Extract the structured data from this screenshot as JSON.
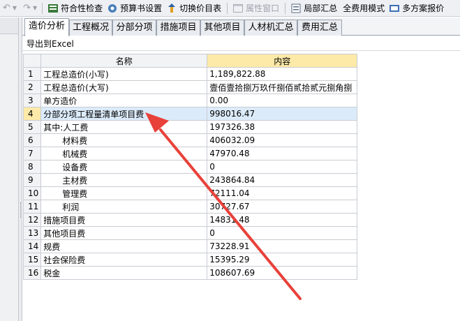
{
  "toolbar": {
    "buttons": [
      {
        "label": "符合性检查",
        "icon": "check-icon",
        "enabled": true
      },
      {
        "label": "预算书设置",
        "icon": "settings-icon",
        "enabled": true
      },
      {
        "label": "切换价目表",
        "icon": "switch-icon",
        "enabled": true
      },
      {
        "label": "属性窗口",
        "icon": "window-icon",
        "enabled": false
      },
      {
        "label": "局部汇总",
        "icon": "summary-icon",
        "enabled": true
      },
      {
        "label": "全费用模式",
        "icon": "",
        "enabled": true
      },
      {
        "label": "多方案报价",
        "icon": "multi-icon",
        "enabled": true
      }
    ]
  },
  "tabs": [
    "造价分析",
    "工程概况",
    "分部分项",
    "措施项目",
    "其他项目",
    "人材机汇总",
    "费用汇总"
  ],
  "active_tab": "造价分析",
  "export_label": "导出到Excel",
  "grid": {
    "headers": {
      "name": "名称",
      "content": "内容"
    },
    "rows": [
      {
        "no": "1",
        "name": "工程总造价(小写)",
        "value": "1,189,822.88"
      },
      {
        "no": "2",
        "name": "工程总造价(大写)",
        "value": "壹佰壹拾捌万玖仟捌佰贰拾贰元捌角捌"
      },
      {
        "no": "3",
        "name": "单方造价",
        "value": "0.00"
      },
      {
        "no": "4",
        "name": "分部分项工程量清单项目费",
        "value": "998016.47"
      },
      {
        "no": "5",
        "name": "其中:人工费",
        "value": "197326.38"
      },
      {
        "no": "6",
        "name": "材料费",
        "value": "406032.09"
      },
      {
        "no": "7",
        "name": "机械费",
        "value": "47970.48"
      },
      {
        "no": "8",
        "name": "设备费",
        "value": "0"
      },
      {
        "no": "9",
        "name": "主材费",
        "value": "243864.84"
      },
      {
        "no": "10",
        "name": "管理费",
        "value": "72111.04"
      },
      {
        "no": "11",
        "name": "利润",
        "value": "30727.67"
      },
      {
        "no": "12",
        "name": "措施项目费",
        "value": "14831.48"
      },
      {
        "no": "13",
        "name": "其他项目费",
        "value": "0"
      },
      {
        "no": "14",
        "name": "规费",
        "value": "73228.91"
      },
      {
        "no": "15",
        "name": "社会保险费",
        "value": "15395.29"
      },
      {
        "no": "16",
        "name": "税金",
        "value": "108607.69"
      }
    ],
    "selected_row": 4
  },
  "colors": {
    "header_content": "#fde9a8",
    "selected_row": "#dcebfa",
    "arrow": "#e8413a"
  }
}
